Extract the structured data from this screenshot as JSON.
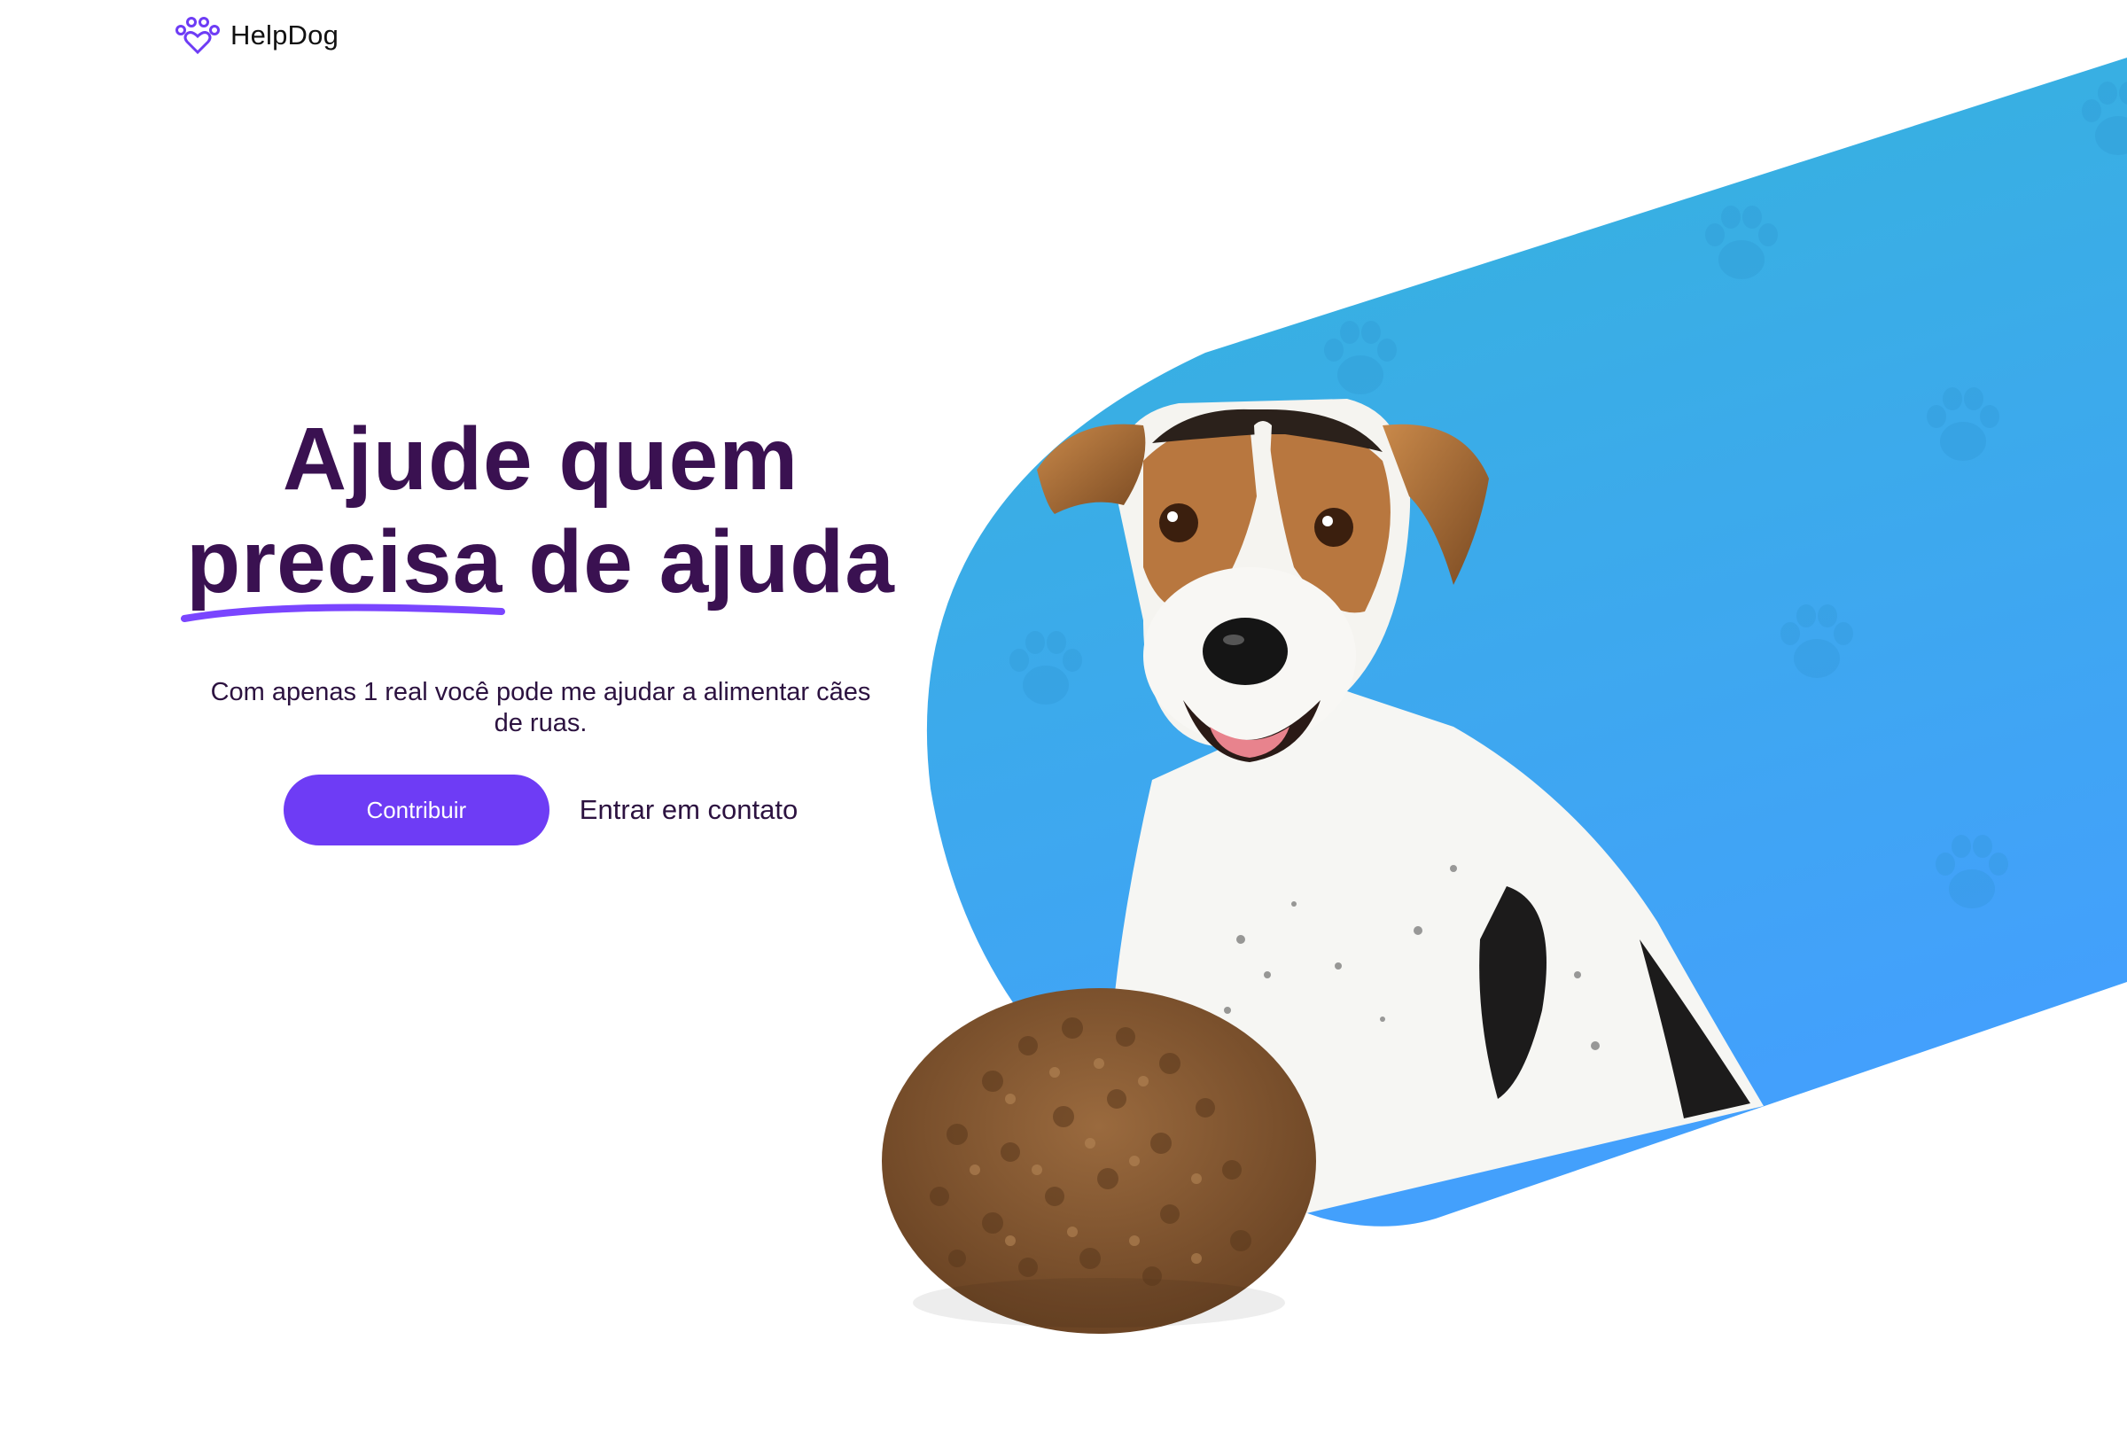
{
  "header": {
    "brand_name": "HelpDog",
    "brand_icon": "paw-heart-icon"
  },
  "hero": {
    "title_line1": "Ajude quem",
    "title_highlight": "precisa",
    "title_rest": "de ajuda",
    "subtitle": "Com apenas 1 real você pode me ajudar a alimentar cães de ruas.",
    "primary_button": "Contribuir",
    "secondary_link": "Entrar em contato"
  },
  "colors": {
    "brand_purple": "#6e3cf5",
    "title_dark_purple": "#3a1151",
    "blue_gradient_top": "#35b3dc",
    "blue_gradient_bottom": "#42a0fb"
  }
}
